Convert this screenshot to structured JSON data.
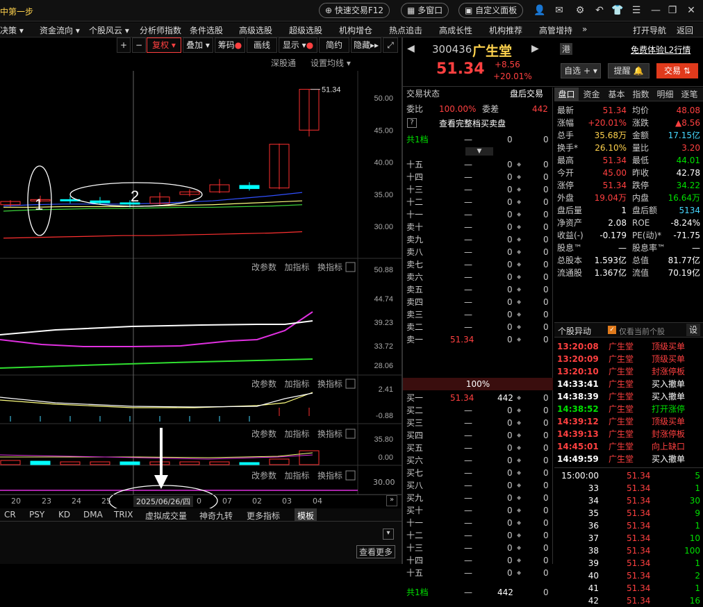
{
  "titlebar": {
    "title": "中第一步",
    "quick_trade": "快速交易F12",
    "multi_window": "多窗口",
    "custom_panel": "自定义面板"
  },
  "menu": [
    "决策 ▾",
    "资金流向 ▾",
    "个股风云 ▾",
    "分析师指数",
    "条件选股",
    "高级选股",
    "超级选股",
    "机构增仓",
    "热点追击",
    "高成长性",
    "机构推荐",
    "高管增持",
    "»",
    "打开导航",
    "返回"
  ],
  "chart_toolbar": {
    "plus": "+",
    "minus": "−",
    "fuquan": "复权",
    "overlay": "叠加",
    "chouma": "筹码",
    "huaxian": "画线",
    "xianshi": "显示",
    "jianyue": "简约",
    "yincang": "隐藏"
  },
  "main_chart": {
    "shengutong": "深股通",
    "set_ma": "设置均线",
    "last_label": "51.34",
    "annotation_1": "1",
    "annotation_2": "2"
  },
  "indicator_labels": {
    "params": "改参数",
    "add": "加指标",
    "switch": "换指标"
  },
  "chart_data": [
    {
      "type": "candlestick",
      "ylim": [
        27,
        54
      ],
      "yticks": [
        "50.00",
        "45.00",
        "40.00",
        "35.00",
        "30.00"
      ],
      "candles": [
        {
          "o": 33.4,
          "c": 33.9,
          "h": 34.1,
          "l": 33.1
        },
        {
          "o": 34.1,
          "c": 34.2,
          "h": 34.8,
          "l": 33.8
        },
        {
          "o": 34.2,
          "c": 34.0,
          "h": 34.7,
          "l": 33.6
        },
        {
          "o": 34.0,
          "c": 33.7,
          "h": 34.6,
          "l": 33.4
        },
        {
          "o": 33.7,
          "c": 33.5,
          "h": 34.1,
          "l": 33.0
        },
        {
          "o": 33.6,
          "c": 34.6,
          "h": 35.3,
          "l": 33.4
        },
        {
          "o": 35.0,
          "c": 35.4,
          "h": 35.8,
          "l": 34.7
        },
        {
          "o": 35.4,
          "c": 36.5,
          "h": 37.4,
          "l": 35.2
        },
        {
          "o": 36.4,
          "c": 35.9,
          "h": 36.9,
          "l": 35.6
        },
        {
          "o": 36.0,
          "c": 42.8,
          "h": 42.9,
          "l": 35.8
        },
        {
          "o": 45.0,
          "c": 51.34,
          "h": 51.34,
          "l": 44.01
        }
      ]
    },
    {
      "type": "line",
      "yticks": [
        "50.88",
        "44.74",
        "39.23",
        "33.72",
        "28.06"
      ],
      "series": [
        {
          "values": [
            36.8,
            36.4,
            36.2,
            36.0,
            36.2,
            36.4,
            36.8,
            37.1,
            37.5,
            38.2,
            40.4
          ]
        }
      ]
    },
    {
      "type": "line",
      "yticks": [
        "2.41",
        "-0.88"
      ]
    },
    {
      "type": "bar",
      "yticks": [
        "35.80",
        "0.00"
      ]
    }
  ],
  "timeline": {
    "dates": [
      "20",
      "23",
      "24",
      "25",
      "2025/06/26/四",
      "0",
      "07",
      "02",
      "03",
      "04"
    ]
  },
  "bottom_tabs": [
    "CR",
    "PSY",
    "KD",
    "DMA",
    "TRIX",
    "虚拟成交量",
    "神奇九转",
    "更多指标",
    "模板"
  ],
  "see_more": "查看更多",
  "last_indicator_tick": "30.00",
  "stock": {
    "code": "300436",
    "name": "广生堂",
    "gang": "港",
    "free_l2": "免费体验L2行情",
    "price": "51.34",
    "change": "+8.56",
    "pct": "+20.01%",
    "zixuan": "自选",
    "tixing": "提醒",
    "jiaoyi": "交易"
  },
  "orderbook": {
    "status_label": "交易状态",
    "status_value": "盘后交易",
    "weibi_label": "委比",
    "weibi_value": "100.00%",
    "weicha_label": "委差",
    "weicha_value": "442",
    "q": "?",
    "full_book": "查看完整档买卖盘",
    "top_label": "共1档",
    "dash": "—",
    "zero": "0",
    "middle": "100%",
    "sells": [
      "十五",
      "十四",
      "十三",
      "十二",
      "十一",
      "卖十",
      "卖九",
      "卖八",
      "卖七",
      "卖六",
      "卖五",
      "卖四",
      "卖三",
      "卖二",
      "卖一"
    ],
    "sell1_price": "51.34",
    "buys": [
      "买一",
      "买二",
      "买三",
      "买四",
      "买五",
      "买六",
      "买七",
      "买八",
      "买九",
      "买十",
      "十一",
      "十二",
      "十三",
      "十四",
      "十五"
    ],
    "buy1_price": "51.34",
    "buy1_vol": "442",
    "bottom_label": "共1档",
    "bottom_vol": "442"
  },
  "tabs": [
    "盘口",
    "资金",
    "基本",
    "指数",
    "明细",
    "逐笔"
  ],
  "quote": [
    [
      "最新",
      "51.34",
      "均价",
      "48.08"
    ],
    [
      "涨幅",
      "+20.01%",
      "涨跌",
      "▲8.56"
    ],
    [
      "总手",
      "35.68万",
      "金额",
      "17.15亿"
    ],
    [
      "换手*",
      "26.10%",
      "量比",
      "3.20"
    ],
    [
      "最高",
      "51.34",
      "最低",
      "44.01"
    ],
    [
      "今开",
      "45.00",
      "昨收",
      "42.78"
    ],
    [
      "涨停",
      "51.34",
      "跌停",
      "34.22"
    ],
    [
      "外盘",
      "19.04万",
      "内盘",
      "16.64万"
    ],
    [
      "盘后量",
      "1",
      "盘后额",
      "5134"
    ],
    [
      "净资产",
      "2.08",
      "ROE",
      "-8.24%"
    ],
    [
      "收益(-)",
      "-0.179",
      "PE(动)*",
      "-71.75"
    ],
    [
      "股息™",
      "—",
      "股息率™",
      "—"
    ],
    [
      "总股本",
      "1.593亿",
      "总值",
      "81.77亿"
    ],
    [
      "流通股",
      "1.367亿",
      "流值",
      "70.19亿"
    ]
  ],
  "alerts_header": {
    "title": "个股异动",
    "only_current": "仅看当前个股",
    "settings": "设"
  },
  "alerts": [
    [
      "13:20:08",
      "广生堂",
      "顶级买单",
      "red"
    ],
    [
      "13:20:09",
      "广生堂",
      "顶级买单",
      "red"
    ],
    [
      "13:20:10",
      "广生堂",
      "封涨停板",
      "red"
    ],
    [
      "14:33:41",
      "广生堂",
      "买入撤单",
      "white"
    ],
    [
      "14:38:39",
      "广生堂",
      "买入撤单",
      "white"
    ],
    [
      "14:38:52",
      "广生堂",
      "打开涨停",
      "green"
    ],
    [
      "14:39:12",
      "广生堂",
      "顶级买单",
      "red"
    ],
    [
      "14:39:13",
      "广生堂",
      "封涨停板",
      "red"
    ],
    [
      "14:45:01",
      "广生堂",
      "向上缺口",
      "red"
    ],
    [
      "14:49:59",
      "广生堂",
      "买入撤单",
      "white"
    ]
  ],
  "ticks": [
    [
      "15:00:00",
      "51.34",
      "5"
    ],
    [
      "33",
      "51.34",
      "1"
    ],
    [
      "34",
      "51.34",
      "30"
    ],
    [
      "35",
      "51.34",
      "9"
    ],
    [
      "36",
      "51.34",
      "1"
    ],
    [
      "37",
      "51.34",
      "10"
    ],
    [
      "38",
      "51.34",
      "100"
    ],
    [
      "39",
      "51.34",
      "1"
    ],
    [
      "40",
      "51.34",
      "2"
    ],
    [
      "41",
      "51.34",
      "1"
    ],
    [
      "42",
      "51.34",
      "16"
    ]
  ]
}
